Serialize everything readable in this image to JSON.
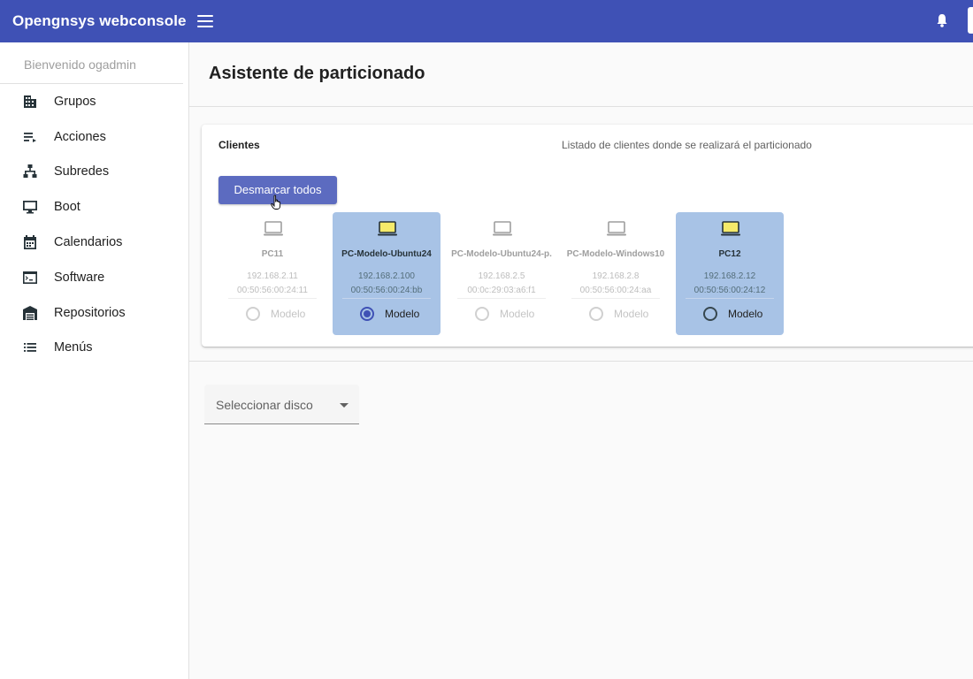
{
  "header": {
    "title": "Opengnsys webconsole",
    "menu_icon": "hamburger-menu-icon",
    "notifications_icon": "bell-icon",
    "color": "#3f51b5"
  },
  "sidebar": {
    "welcome": "Bienvenido ogadmin",
    "items": [
      {
        "label": "Grupos",
        "icon": "building-icon"
      },
      {
        "label": "Acciones",
        "icon": "playlist-icon"
      },
      {
        "label": "Subredes",
        "icon": "network-icon"
      },
      {
        "label": "Boot",
        "icon": "monitor-icon"
      },
      {
        "label": "Calendarios",
        "icon": "calendar-icon"
      },
      {
        "label": "Software",
        "icon": "console-icon"
      },
      {
        "label": "Repositorios",
        "icon": "warehouse-icon"
      },
      {
        "label": "Menús",
        "icon": "list-icon"
      }
    ]
  },
  "main": {
    "title": "Asistente de particionado",
    "clients_card": {
      "title": "Clientes",
      "subtitle": "Listado de clientes donde se realizará el particionado",
      "button_label": "Desmarcar todos",
      "clients": [
        {
          "name": "PC11",
          "ip": "192.168.2.11",
          "mac": "00:50:56:00:24:11",
          "radio_label": "Modelo",
          "selected": false,
          "model_checked": false
        },
        {
          "name": "PC-Modelo-Ubuntu24",
          "ip": "192.168.2.100",
          "mac": "00:50:56:00:24:bb",
          "radio_label": "Modelo",
          "selected": true,
          "model_checked": true
        },
        {
          "name": "PC-Modelo-Ubuntu24-p.",
          "ip": "192.168.2.5",
          "mac": "00:0c:29:03:a6:f1",
          "radio_label": "Modelo",
          "selected": false,
          "model_checked": false
        },
        {
          "name": "PC-Modelo-Windows10",
          "ip": "192.168.2.8",
          "mac": "00:50:56:00:24:aa",
          "radio_label": "Modelo",
          "selected": false,
          "model_checked": false
        },
        {
          "name": "PC12",
          "ip": "192.168.2.12",
          "mac": "00:50:56:00:24:12",
          "radio_label": "Modelo",
          "selected": true,
          "model_checked": false
        }
      ]
    },
    "disk_select": {
      "label": "Seleccionar disco"
    }
  }
}
